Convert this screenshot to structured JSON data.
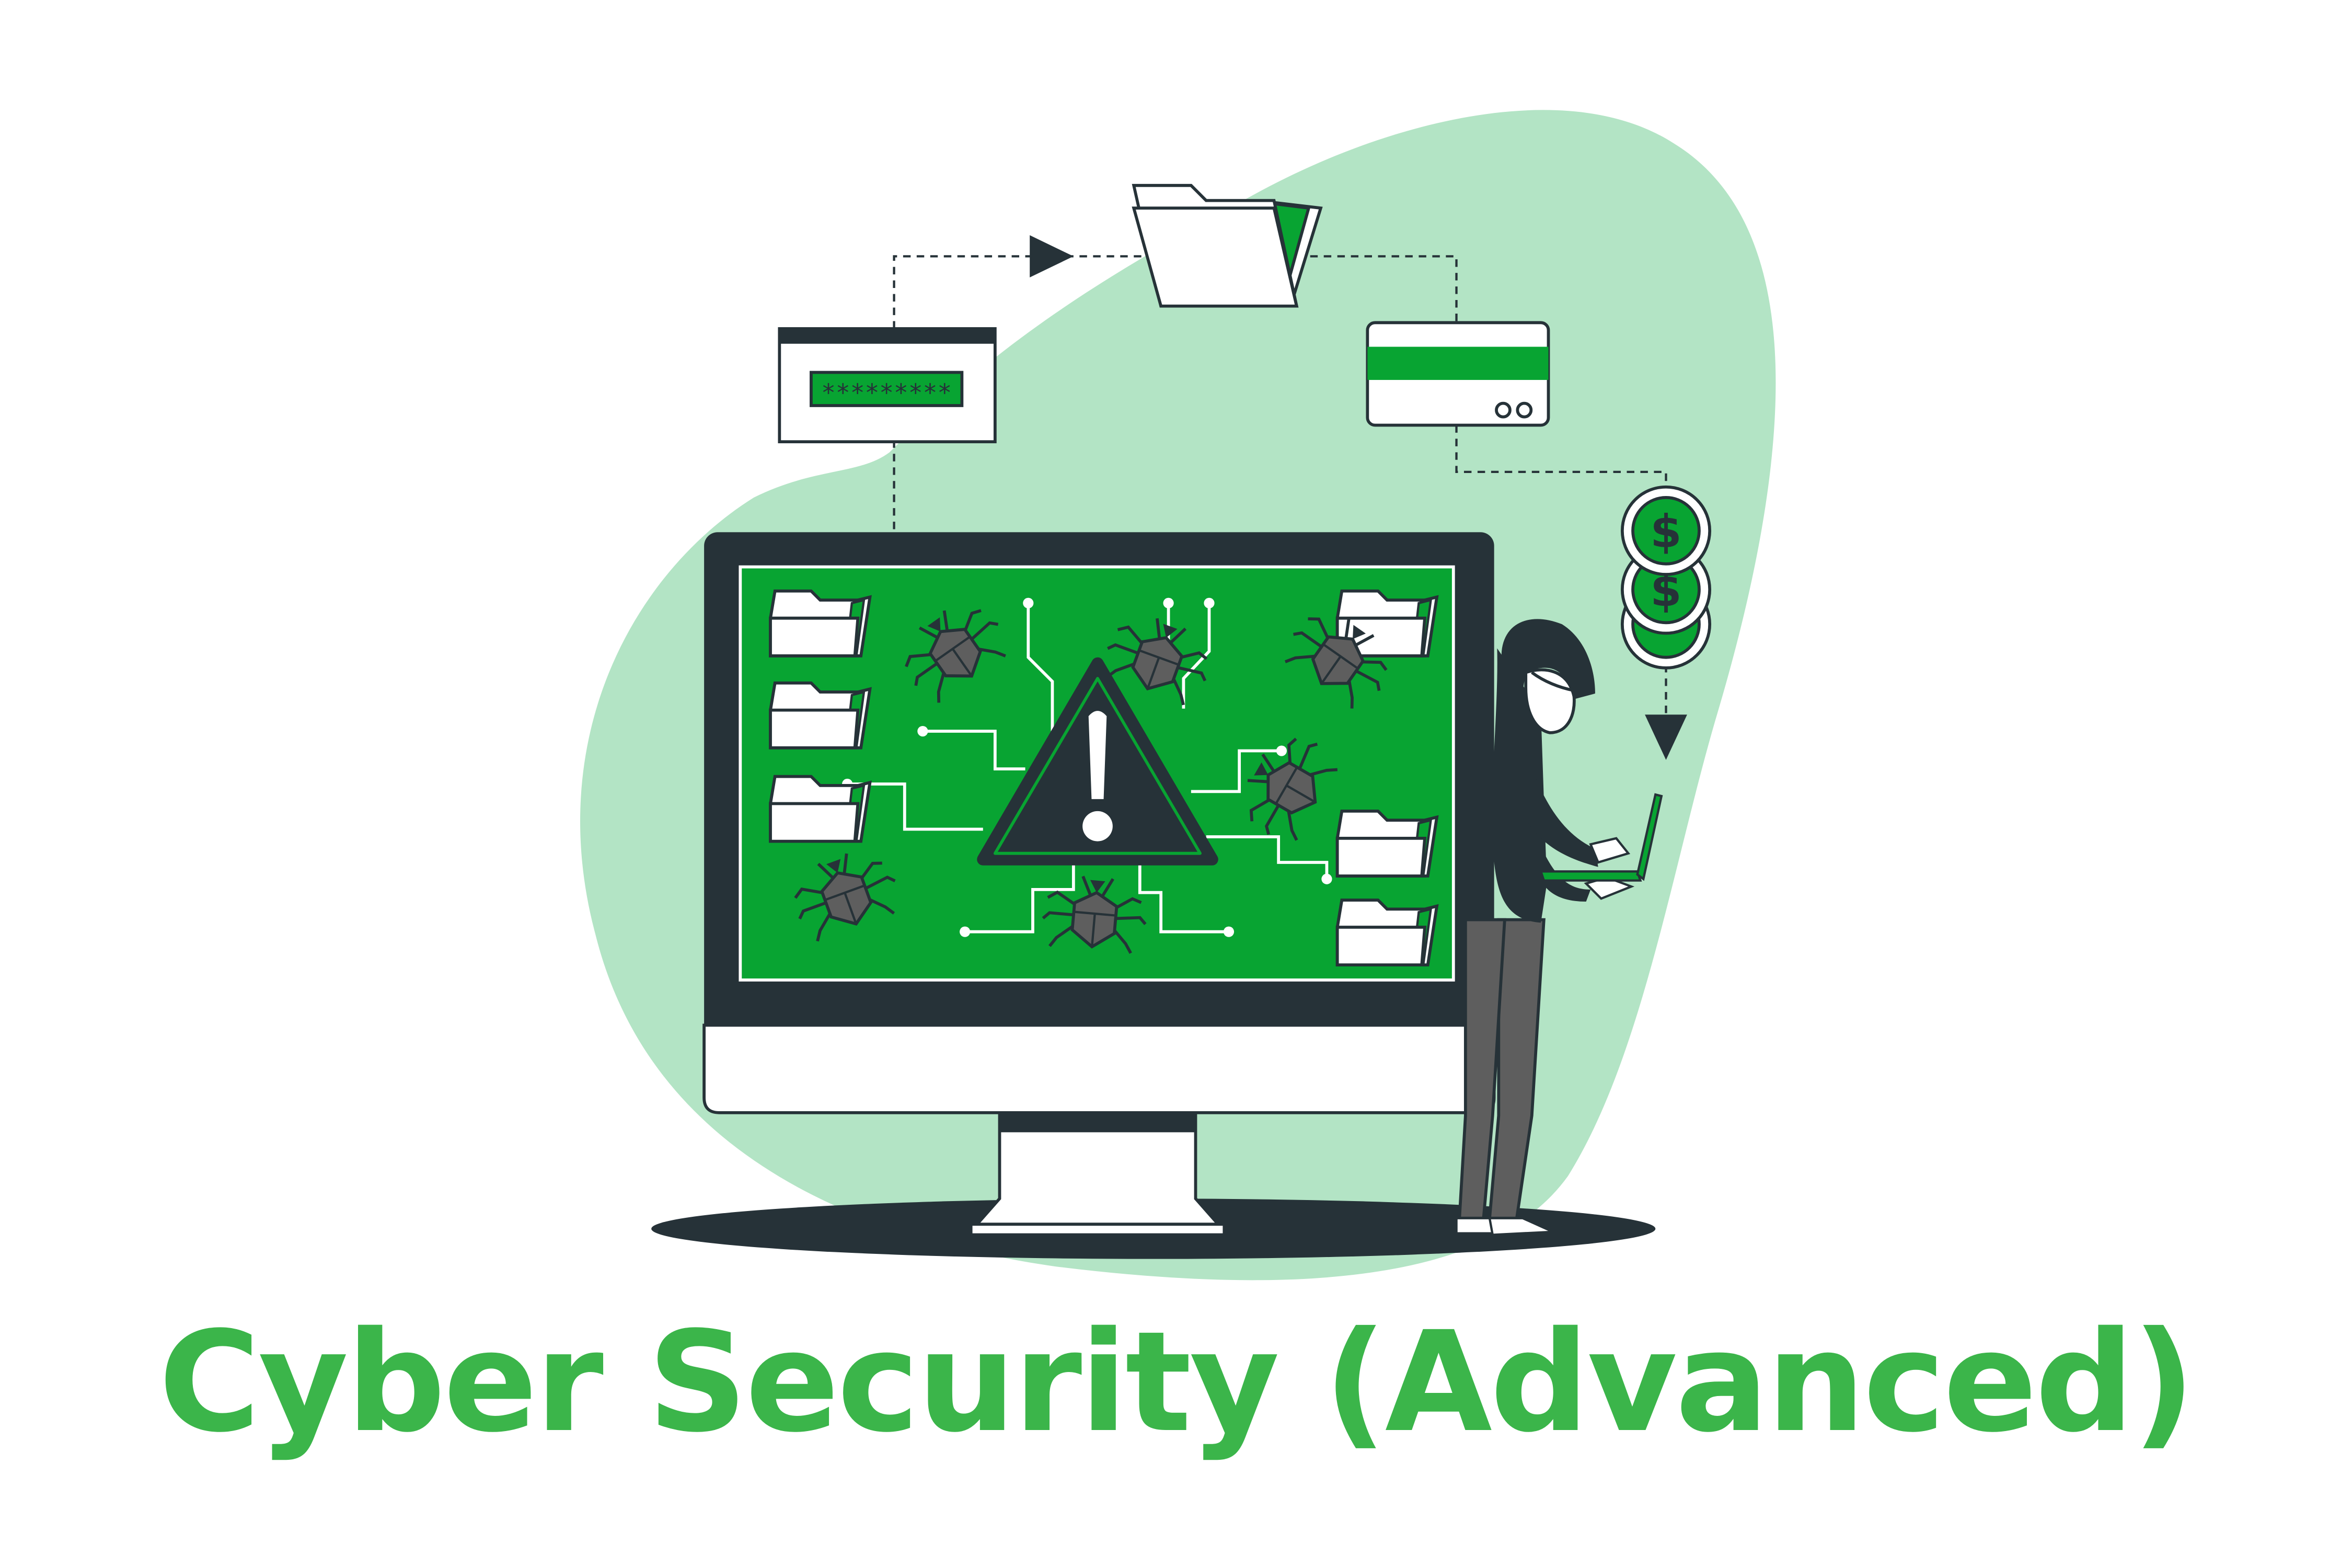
{
  "title": "Cyber Security (Advanced)",
  "password_field": {
    "masked_value": "*********"
  },
  "coin_symbol": "$",
  "colors": {
    "accent_green": "#08a432",
    "title_green": "#3bb54a",
    "blob_green": "#b3e4c5",
    "dark": "#263238",
    "bug_gray": "#5e5e5e",
    "white": "#ffffff"
  },
  "icons": [
    "password-window-icon",
    "folder-icon",
    "credit-card-icon",
    "dollar-coin-icon",
    "warning-icon",
    "bug-icon",
    "hooded-hacker-figure",
    "laptop-icon",
    "desktop-monitor"
  ]
}
